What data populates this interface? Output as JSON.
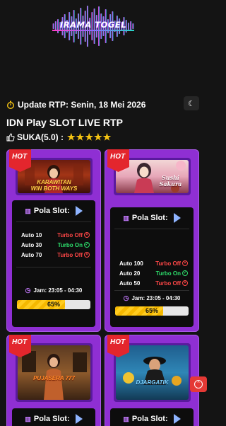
{
  "brand": {
    "logo_text": "IRAMA TOGEL"
  },
  "update": {
    "label": "Update RTP: Senin, 18 Mei 2026"
  },
  "heading": "IDN Play SLOT LIVE RTP",
  "rating": {
    "label": "SUKA(5.0) :",
    "stars": "★★★★★",
    "value": 5
  },
  "theme_toggle": {
    "icon": "moon-icon",
    "glyph": "☾"
  },
  "colors": {
    "card": "#8f2fd3",
    "turbo_on": "#2ddf6c",
    "turbo_off": "#ff4747",
    "progress": "#f5b800",
    "hot": "#e3262d"
  },
  "cards": [
    {
      "badge": "HOT",
      "game_title": "KARAWITAN\nWIN BOTH WAYS",
      "pola_label": "Pola Slot:",
      "rows": [
        {
          "auto": "Auto 10",
          "turbo": "Turbo Off",
          "on": false
        },
        {
          "auto": "Auto 30",
          "turbo": "Turbo On",
          "on": true
        },
        {
          "auto": "Auto 70",
          "turbo": "Turbo Off",
          "on": false
        }
      ],
      "jam": "Jam: 23:05 - 04:30",
      "rtp_label": "65%",
      "rtp_value": 65
    },
    {
      "badge": "HOT",
      "game_title": "Sushi Sakura",
      "pola_label": "Pola Slot:",
      "rows": [
        {
          "auto": "Auto 100",
          "turbo": "Turbo Off",
          "on": false
        },
        {
          "auto": "Auto 20",
          "turbo": "Turbo On",
          "on": true
        },
        {
          "auto": "Auto 50",
          "turbo": "Turbo Off",
          "on": false
        }
      ],
      "jam": "Jam: 23:05 - 04:30",
      "rtp_label": "65%",
      "rtp_value": 65
    },
    {
      "badge": "HOT",
      "game_title": "PUJASERA 777",
      "pola_label": "Pola Slot:"
    },
    {
      "badge": "HOT",
      "game_title": "DJARGATIK",
      "pola_label": "Pola Slot:"
    }
  ],
  "scroll_top": {
    "icon": "chevron-up-icon",
    "glyph": "⌃"
  }
}
